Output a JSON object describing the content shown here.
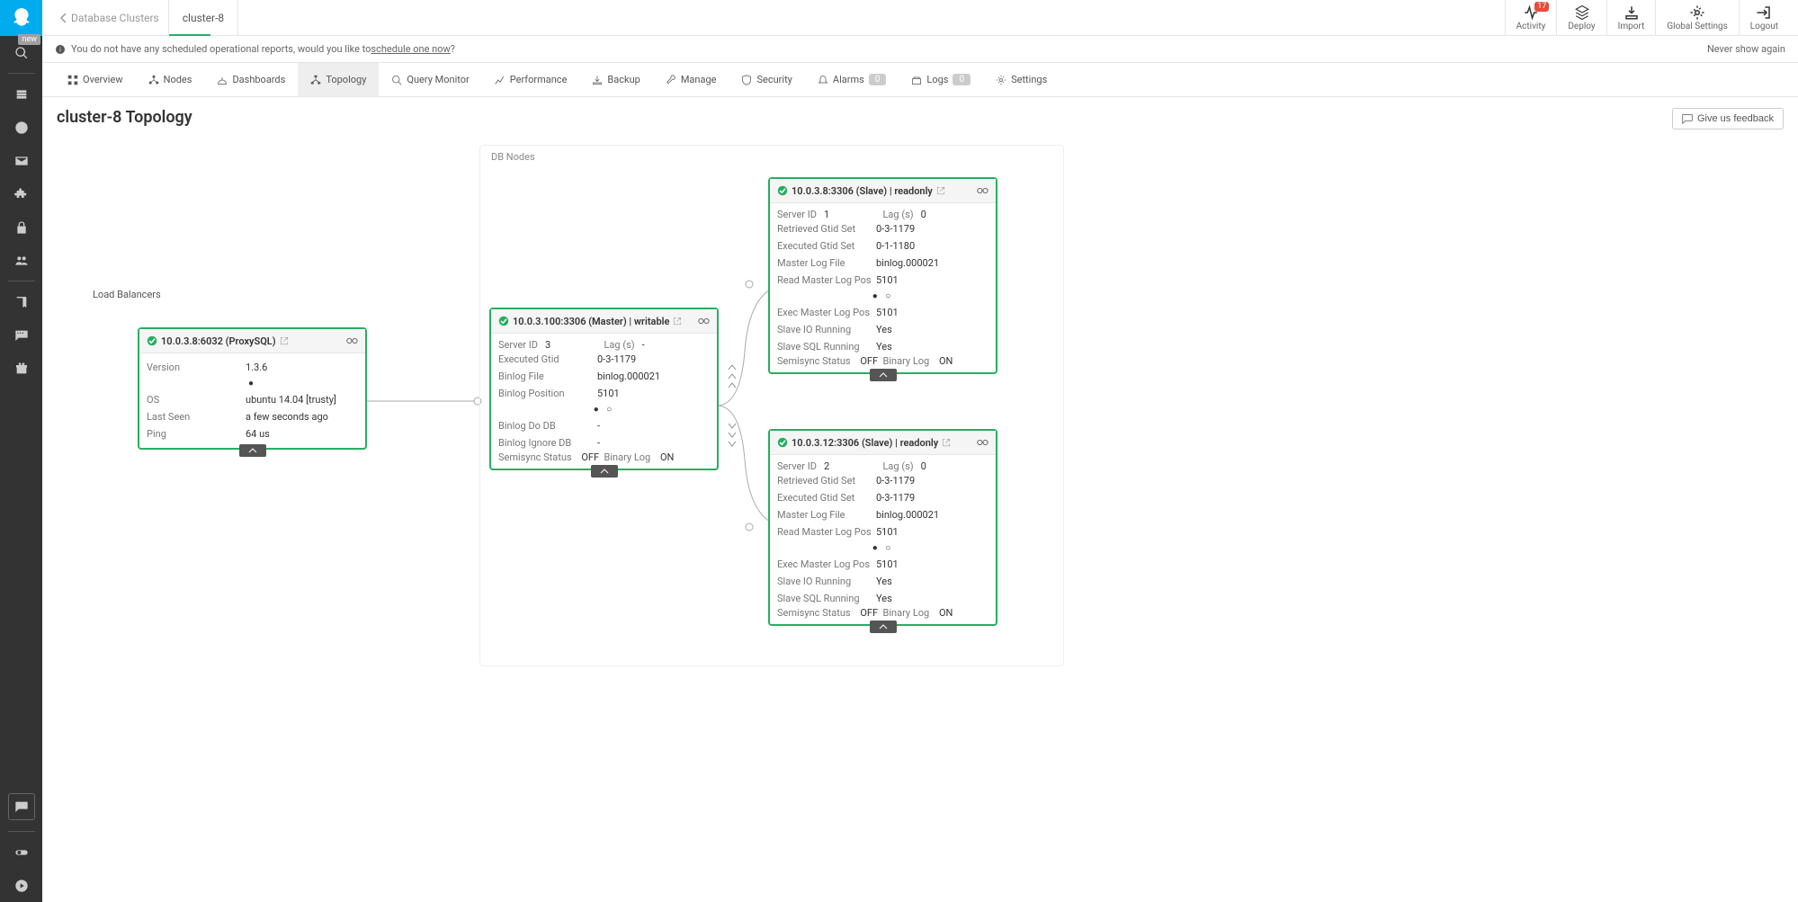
{
  "sidenav": {
    "new_badge": "new"
  },
  "breadcrumb": {
    "parent": "Database Clusters",
    "current": "cluster-8"
  },
  "topnav": {
    "activity": "Activity",
    "activity_badge": "17",
    "deploy": "Deploy",
    "import": "Import",
    "global_settings": "Global Settings",
    "logout": "Logout"
  },
  "notice": {
    "text_lead": "You do not have any scheduled operational reports, would you like to ",
    "link": "schedule one now",
    "text_tail": "?",
    "dismiss": "Never show again"
  },
  "tabs": {
    "overview": "Overview",
    "nodes": "Nodes",
    "dashboards": "Dashboards",
    "topology": "Topology",
    "query_monitor": "Query Monitor",
    "performance": "Performance",
    "backup": "Backup",
    "manage": "Manage",
    "security": "Security",
    "alarms": "Alarms",
    "alarms_badge": "0",
    "logs": "Logs",
    "logs_badge": "0",
    "settings": "Settings"
  },
  "page": {
    "title": "cluster-8 Topology",
    "feedback": "Give us feedback"
  },
  "lb": {
    "section_label": "Load Balancers",
    "node": {
      "title": "10.0.3.8:6032 (ProxySQL)",
      "version_k": "Version",
      "version_v": "1.3.6",
      "os_k": "OS",
      "os_v": "ubuntu 14.04 [trusty]",
      "lastseen_k": "Last Seen",
      "lastseen_v": "a few seconds ago",
      "ping_k": "Ping",
      "ping_v": "64 us"
    }
  },
  "db": {
    "section_label": "DB Nodes",
    "master": {
      "title": "10.0.3.100:3306 (Master) | writable",
      "server_id_k": "Server ID",
      "server_id_v": "3",
      "lag_k": "Lag (s)",
      "lag_v": "-",
      "exec_gtid_k": "Executed Gtid",
      "exec_gtid_v": "0-3-1179",
      "binlog_file_k": "Binlog File",
      "binlog_file_v": "binlog.000021",
      "binlog_pos_k": "Binlog Position",
      "binlog_pos_v": "5101",
      "binlog_do_k": "Binlog Do DB",
      "binlog_do_v": "-",
      "binlog_ignore_k": "Binlog Ignore DB",
      "binlog_ignore_v": "-",
      "semisync_k": "Semisync Status",
      "semisync_v": "OFF",
      "binary_log_k": "Binary Log",
      "binary_log_v": "ON"
    },
    "slave1": {
      "title": "10.0.3.8:3306 (Slave) | readonly",
      "server_id_k": "Server ID",
      "server_id_v": "1",
      "lag_k": "Lag (s)",
      "lag_v": "0",
      "ret_gtid_k": "Retrieved Gtid Set",
      "ret_gtid_v": "0-3-1179",
      "exec_gtid_k": "Executed Gtid Set",
      "exec_gtid_v": "0-1-1180",
      "mlf_k": "Master Log File",
      "mlf_v": "binlog.000021",
      "rmlp_k": "Read Master Log Pos",
      "rmlp_v": "5101",
      "emlp_k": "Exec Master Log Pos",
      "emlp_v": "5101",
      "sio_k": "Slave IO Running",
      "sio_v": "Yes",
      "ssql_k": "Slave SQL Running",
      "ssql_v": "Yes",
      "semisync_k": "Semisync Status",
      "semisync_v": "OFF",
      "binary_log_k": "Binary Log",
      "binary_log_v": "ON"
    },
    "slave2": {
      "title": "10.0.3.12:3306 (Slave) | readonly",
      "server_id_k": "Server ID",
      "server_id_v": "2",
      "lag_k": "Lag (s)",
      "lag_v": "0",
      "ret_gtid_k": "Retrieved Gtid Set",
      "ret_gtid_v": "0-3-1179",
      "exec_gtid_k": "Executed Gtid Set",
      "exec_gtid_v": "0-3-1179",
      "mlf_k": "Master Log File",
      "mlf_v": "binlog.000021",
      "rmlp_k": "Read Master Log Pos",
      "rmlp_v": "5101",
      "emlp_k": "Exec Master Log Pos",
      "emlp_v": "5101",
      "sio_k": "Slave IO Running",
      "sio_v": "Yes",
      "ssql_k": "Slave SQL Running",
      "ssql_v": "Yes",
      "semisync_k": "Semisync Status",
      "semisync_v": "OFF",
      "binary_log_k": "Binary Log",
      "binary_log_v": "ON"
    }
  }
}
